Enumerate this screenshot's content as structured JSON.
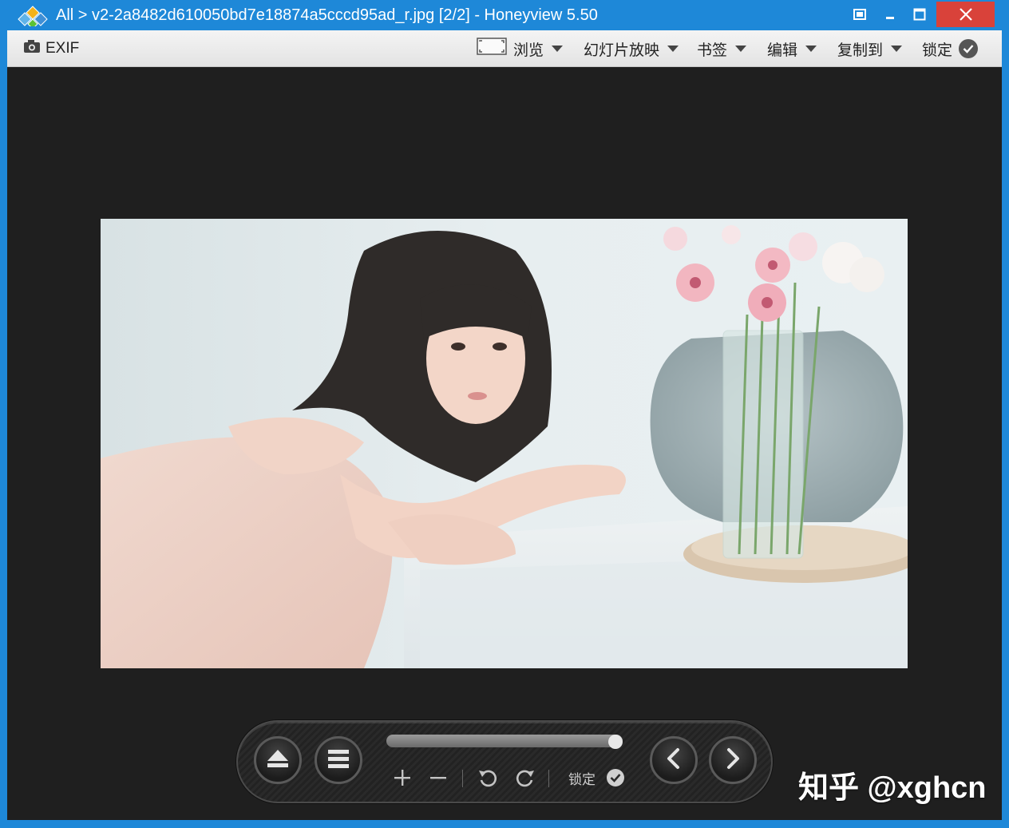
{
  "titlebar": {
    "title": "All > v2-2a8482d610050bd7e18874a5cccd95ad_r.jpg [2/2] - Honeyview 5.50"
  },
  "toolbar": {
    "exif_label": "EXIF",
    "browse_label": "浏览",
    "slideshow_label": "幻灯片放映",
    "bookmark_label": "书签",
    "edit_label": "编辑",
    "copyto_label": "复制到",
    "lock_label": "锁定"
  },
  "controls": {
    "lock_label": "锁定",
    "slider_position": 1.0
  },
  "watermark": {
    "text": "知乎 @xghcn"
  }
}
